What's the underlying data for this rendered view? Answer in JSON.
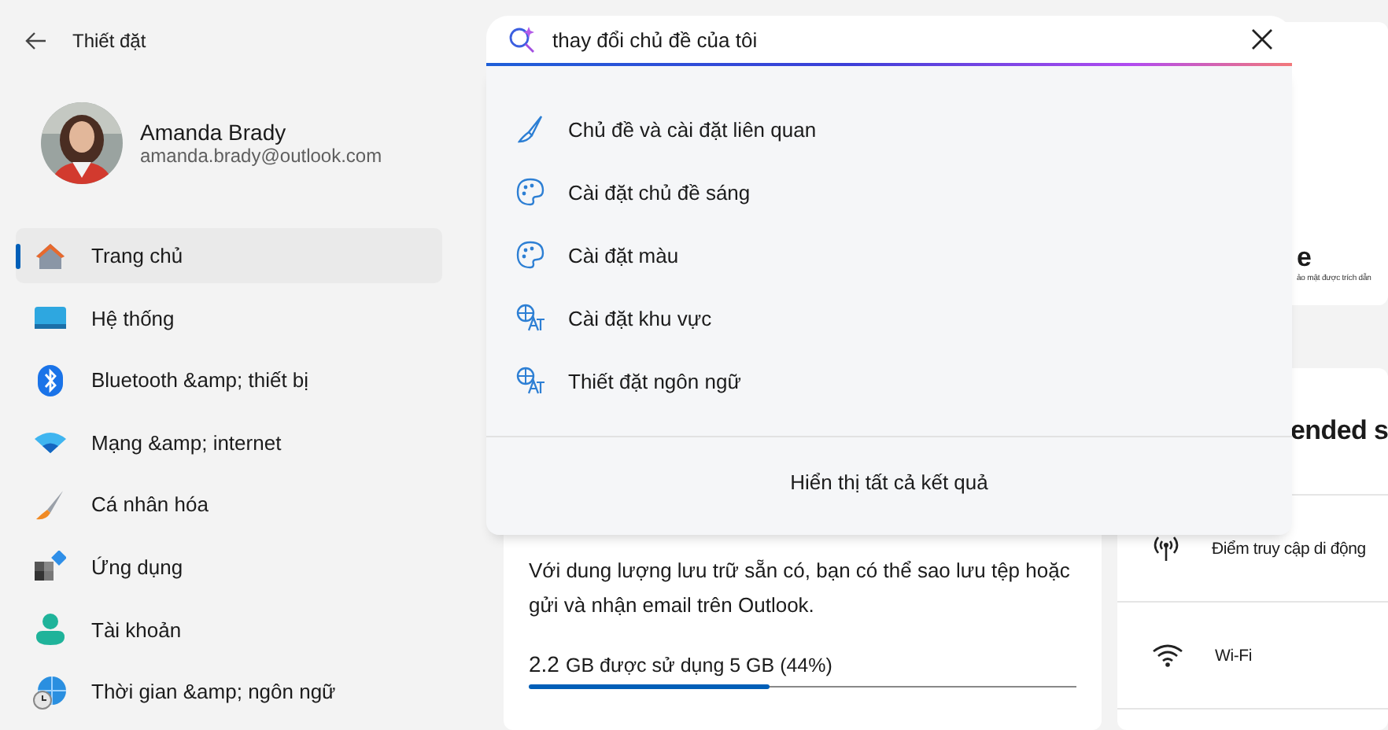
{
  "window": {
    "title": "Thiết đặt"
  },
  "profile": {
    "name": "Amanda Brady",
    "email": "amanda.brady@outlook.com"
  },
  "sidebar": {
    "items": [
      {
        "label": "Trang chủ",
        "selected": true
      },
      {
        "label": "Hệ thống",
        "selected": false
      },
      {
        "label": "Bluetooth &amp; thiết bị",
        "selected": false
      },
      {
        "label": "Mạng &amp; internet",
        "selected": false
      },
      {
        "label": "Cá nhân hóa",
        "selected": false
      },
      {
        "label": "Ứng dụng",
        "selected": false
      },
      {
        "label": "Tài khoản",
        "selected": false
      },
      {
        "label": "Thời gian &amp; ngôn ngữ",
        "selected": false
      }
    ]
  },
  "search": {
    "value": "thay đổi chủ đề của tôi",
    "results": [
      {
        "label": "Chủ đề và cài đặt liên quan"
      },
      {
        "label": "Cài đặt chủ đề sáng"
      },
      {
        "label": "Cài đặt màu"
      },
      {
        "label": "Cài đặt khu vực"
      },
      {
        "label": "Thiết đặt ngôn ngữ"
      }
    ],
    "show_all": "Hiển thị tất cả kết quả"
  },
  "top_card": {
    "title": "e",
    "caption": "ảo mật được trích dẫn"
  },
  "storage_card": {
    "description": "Với dung lượng lưu trữ sẵn có, bạn có thể sao lưu tệp hoặc gửi và nhận email trên Outlook.",
    "used": "2.2",
    "usage_text": "GB được sử dụng 5 GB (44%)",
    "level": 0.44
  },
  "recommended": {
    "title": "ended s",
    "rows": [
      {
        "label": "Điểm truy cập di động"
      },
      {
        "label": "Wi-Fi"
      }
    ]
  }
}
